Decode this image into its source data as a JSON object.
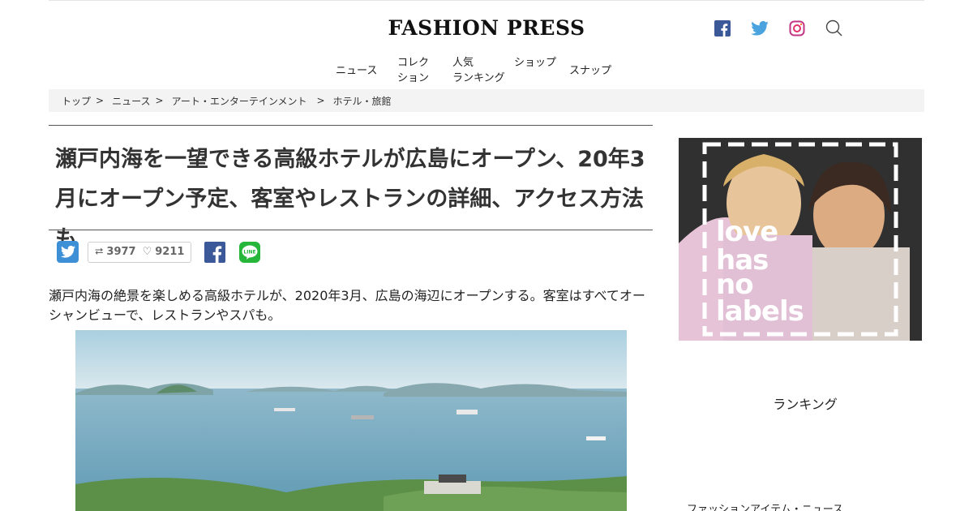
{
  "header": {
    "logo": "FASHION PRESS",
    "social_icons": [
      "facebook-icon",
      "twitter-icon",
      "instagram-icon",
      "search-icon"
    ]
  },
  "nav": [
    {
      "line1": "ニュース",
      "line2": ""
    },
    {
      "line1": "コレク",
      "line2": "ション"
    },
    {
      "line1": "人気",
      "line2": "ランキング"
    },
    {
      "line1": "ショップ",
      "line2": ""
    },
    {
      "line1": "スナップ",
      "line2": ""
    }
  ],
  "breadcrumb": {
    "items": [
      "トップ",
      "ニュース",
      "アート・エンターテインメント",
      "ホテル・旅館"
    ],
    "separator": ">"
  },
  "article": {
    "headline": "瀬戸内海を一望できる高級ホテルが広島にオープン、20年3月にオープン予定、客室やレストランの詳細、アクセス方法も",
    "retweets": "3977",
    "likes": "9211",
    "lead": "瀬戸内海の絶景を楽しめる高級ホテルが、2020年3月、広島の海辺にオープンする。客室はすべてオーシャンビューで、レストランやスパも。"
  },
  "ad": {
    "slogan_lines": [
      "love",
      "has",
      "no",
      "labels"
    ]
  },
  "sidebar": {
    "title": "ランキング",
    "first_item": "ファッションアイテム・ニュース"
  },
  "colors": {
    "twitter": "#3d8fd6",
    "facebook": "#3b5998",
    "line": "#25b63a",
    "instagram": "#c13584",
    "breadcrumb_bg": "#f3f3f3"
  }
}
